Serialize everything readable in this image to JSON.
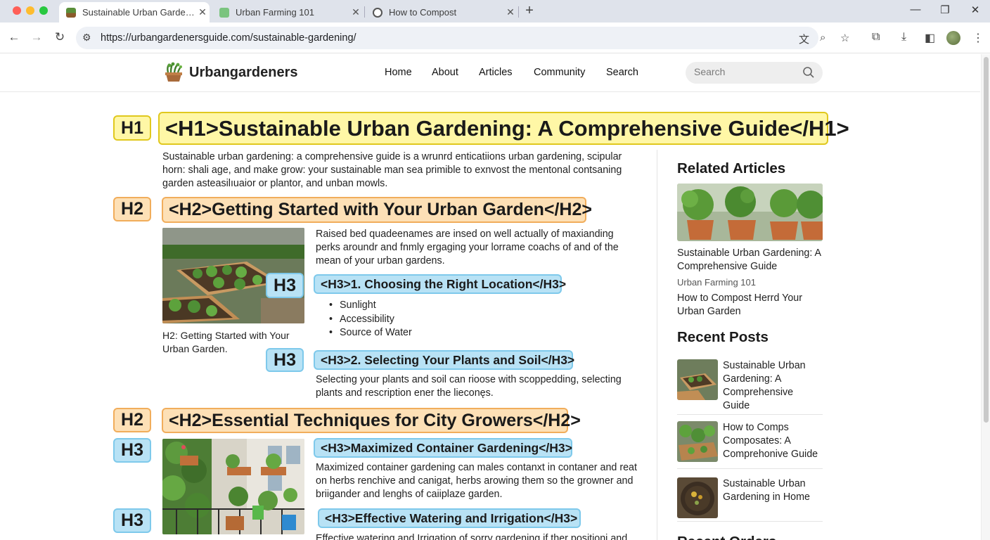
{
  "browser": {
    "tabs": [
      {
        "title": "Sustainable Urban Garde…",
        "active": true,
        "favicon": "garden-favicon"
      },
      {
        "title": "Urban Farming 101",
        "active": false,
        "favicon": "farm-favicon"
      },
      {
        "title": "How to Compost",
        "active": false,
        "favicon": "globe-favicon"
      }
    ],
    "url": "https://urbangardenersguide.com/sustainable-gardening/"
  },
  "site": {
    "logo": "Urbangardeners",
    "nav": [
      "Home",
      "About",
      "Articles",
      "Community",
      "Search"
    ],
    "search_placeholder": "Search"
  },
  "article": {
    "h1_badge": "H1",
    "h1": "<H1>Sustainable Urban Gardening: A Comprehensive Guide</H1>",
    "intro": "Sustainable urban gardening: a comprehensive guide is a wrunrd enticatiions urban gardening, scipular horn: shali age, and make grow: your sustainable man sea primible to exnvost the mentonal contsaning garden asteasilıuaior or plantor, and unban mowls.",
    "section1": {
      "h2_badge": "H2",
      "h2": "<H2>Getting Started with Your Urban Garden</H2>",
      "image_badge": "H3",
      "caption": "H2: Getting Started with Your Urban Garden.",
      "para": "Raised bed quadeenames are insed on well actually of maxianding perks aroundr and fnmly ergaging your lorrame coachs of and of the mean of your urban gardens.",
      "h3a_badge": "H3",
      "h3a": "<H3>1. Choosing the Right Location</H3>",
      "bullets": [
        "Sunlight",
        "Accessibility",
        "Source of Water"
      ],
      "h3b_badge": "H3",
      "h3b": "<H3>2. Selecting Your Plants and Soil</H3>",
      "para2": "Selecting your plants and soil can rioose with scoppedding, selecting plants and rescription ener the lieconęs."
    },
    "section2": {
      "h2_badge": "H2",
      "h2": "<H2>Essential Techniques for City Growers</H2>",
      "h3a_badge": "H3",
      "h3a": "<H3>Maximized Container Gardening</H3>",
      "para": "Maximized container gardening can males contanxt in contaner and reat on herbs renchive and canigat, herbs arowing them so the growner and briigander and lenghs of caiiplaze garden.",
      "h3b_badge": "H3",
      "h3b": "<H3>Effective Watering and Irrigation</H3>",
      "para2": "Effective watering and Irrigation of sorry gardening if ther positioni and"
    }
  },
  "sidebar": {
    "related_heading": "Related Articles",
    "related": [
      "Sustainable Urban Gardening: A Comprehensive Guide",
      "Urban Farming 101",
      "How to Compost Herrd Your Urban Garden"
    ],
    "recent_heading": "Recent Posts",
    "recent": [
      "Sustainable Urban Gardening: A Comprehensive Guide",
      "How to Comps Composates: A Comprehonive Guide",
      "Sustainable Urban Gardening in Home"
    ],
    "next_heading": "Recent Orders"
  },
  "colors": {
    "h1_fill": "#fff7a6",
    "h2_fill": "#fde0b6",
    "h3_fill": "#b8e2f5"
  }
}
